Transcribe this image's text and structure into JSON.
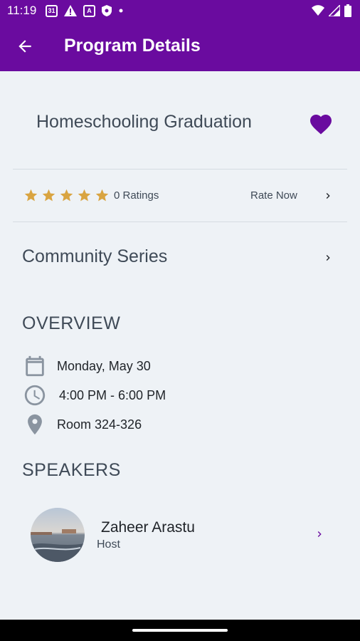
{
  "status_bar": {
    "time": "11:19",
    "calendar_badge": "31",
    "icons": [
      "calendar-icon",
      "alert-icon",
      "notification-box-icon",
      "shield-icon",
      "dot-icon",
      "wifi-icon",
      "cell-signal-icon",
      "battery-icon"
    ]
  },
  "app_bar": {
    "title": "Program Details",
    "back_icon": "arrow-left-icon",
    "background": "#6a0b9f"
  },
  "program": {
    "title": "Homeschooling Graduation",
    "favorite": true,
    "favorite_color": "#6a0b9f"
  },
  "rating": {
    "stars_filled": 5,
    "star_color": "#d9a441",
    "ratings_label": "0 Ratings",
    "rate_now_label": "Rate Now"
  },
  "series": {
    "label": "Community Series"
  },
  "overview": {
    "heading": "OVERVIEW",
    "date": "Monday, May 30",
    "time": "4:00 PM - 6:00 PM",
    "location": "Room 324-326"
  },
  "speakers": {
    "heading": "SPEAKERS",
    "items": [
      {
        "name": "Zaheer Arastu",
        "role": "Host"
      }
    ]
  }
}
